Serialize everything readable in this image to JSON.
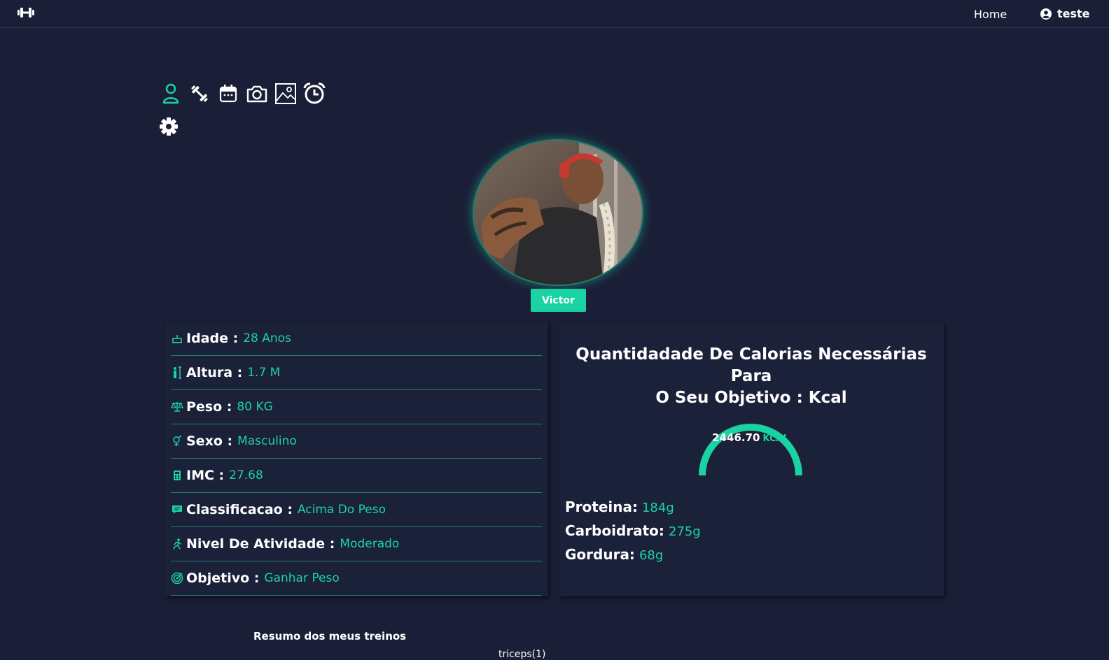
{
  "navbar": {
    "logo_icon": "dumbbell-icon",
    "home_label": "Home",
    "user_label": "teste",
    "user_icon": "user-circle-icon"
  },
  "toolbar": {
    "icons": [
      "user-icon",
      "dumbbell-icon",
      "calendar-icon",
      "camera-icon",
      "image-icon",
      "alarm-clock-icon"
    ],
    "settings_icon": "gear-icon"
  },
  "profile": {
    "name": "Victor",
    "avatar": "profile-photo"
  },
  "info": {
    "rows": [
      {
        "icon": "cake-icon",
        "label": "Idade :",
        "value": "28 Anos"
      },
      {
        "icon": "height-icon",
        "label": "Altura :",
        "value": "1.7 M"
      },
      {
        "icon": "scale-icon",
        "label": "Peso :",
        "value": "80 KG"
      },
      {
        "icon": "gender-icon",
        "label": "Sexo :",
        "value": "Masculino"
      },
      {
        "icon": "calculator-icon",
        "label": "IMC :",
        "value": "27.68"
      },
      {
        "icon": "comment-icon",
        "label": "Classificacao :",
        "value": "Acima Do Peso"
      },
      {
        "icon": "running-icon",
        "label": "Nivel De Atividade :",
        "value": "Moderado"
      },
      {
        "icon": "target-icon",
        "label": "Objetivo :",
        "value": "Ganhar Peso"
      }
    ]
  },
  "calories": {
    "title_line1": "Quantidadade De Calorias Necessárias Para",
    "title_line2": "O Seu Objetivo : Kcal",
    "value": "2446.70",
    "unit": "KCAL",
    "macros": [
      {
        "label": "Proteina:",
        "value": "184g"
      },
      {
        "label": "Carboidrato:",
        "value": "275g"
      },
      {
        "label": "Gordura:",
        "value": "68g"
      }
    ]
  },
  "summary": {
    "title": "Resumo dos meus treinos",
    "legend_partial": "triceps(1)"
  },
  "colors": {
    "background": "#1a1f37",
    "card": "#1c213a",
    "accent": "#19d3a3",
    "text": "#ffffff"
  }
}
